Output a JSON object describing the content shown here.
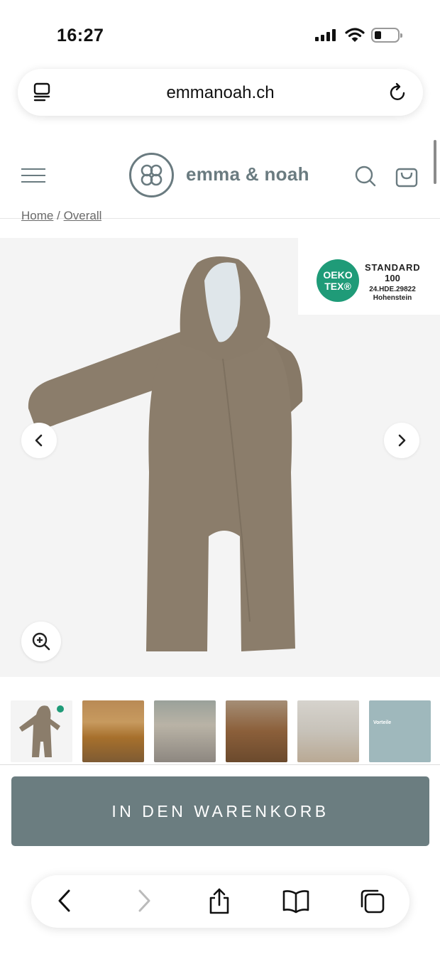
{
  "status_bar": {
    "time": "16:27"
  },
  "browser": {
    "url": "emmanoah.ch"
  },
  "site": {
    "logo_text": "emma & noah"
  },
  "breadcrumb": {
    "home": "Home",
    "separator": "/",
    "current": "Overall"
  },
  "certification": {
    "badge_line1": "OEKO",
    "badge_line2": "TEX®",
    "standard": "STANDARD",
    "number": "100",
    "code": "24.HDE.29822",
    "institute": "Hohenstein"
  },
  "thumbnails": {
    "info_title": "Vorteile"
  },
  "cta": {
    "add_to_cart": "IN DEN WARENKORB"
  },
  "colors": {
    "brand": "#6a7b80",
    "button": "#6b7d80",
    "oeko_green": "#1f9b78",
    "product": "#8b7d6b"
  },
  "icons": [
    "tab-list-icon",
    "reload-icon",
    "hamburger-icon",
    "search-icon",
    "cart-icon",
    "chevron-left-icon",
    "chevron-right-icon",
    "zoom-in-icon",
    "back-icon",
    "forward-icon",
    "share-icon",
    "bookmarks-icon",
    "tabs-icon"
  ]
}
